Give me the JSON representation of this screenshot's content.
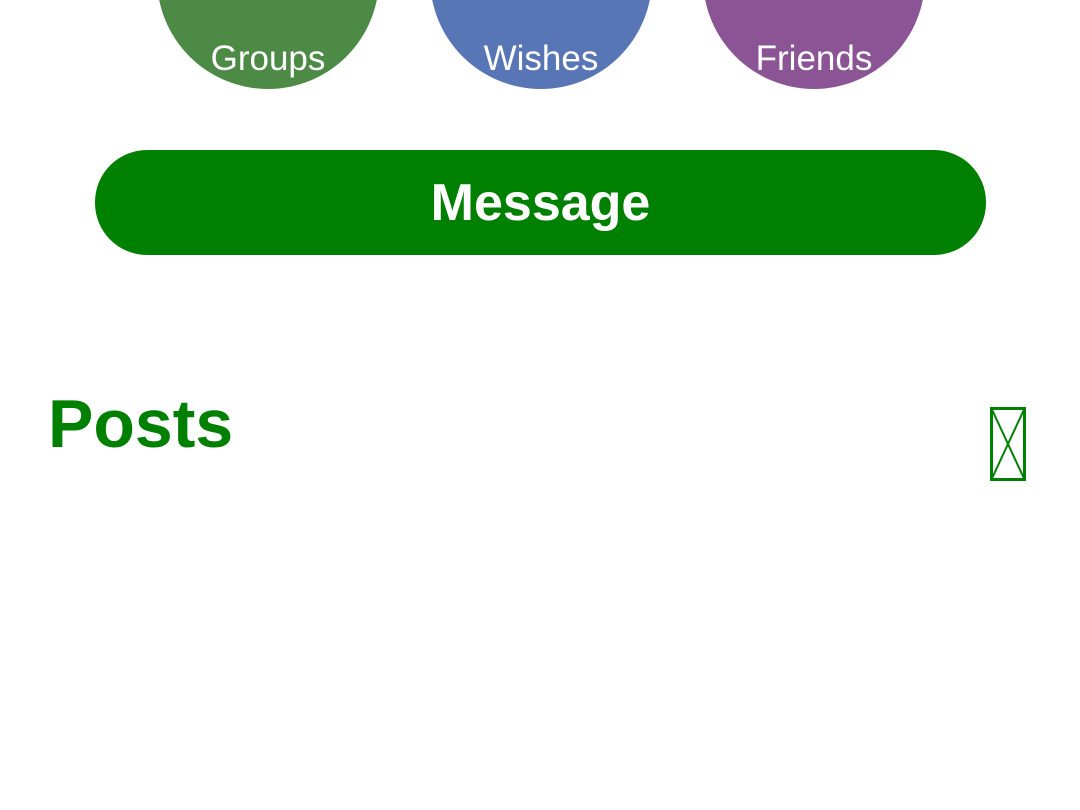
{
  "colors": {
    "groups_circle": "#4c8a45",
    "wishes_circle": "#5875b5",
    "friends_circle": "#8b5595",
    "primary_green": "#008000",
    "background": "#ffffff"
  },
  "shortcuts": [
    {
      "label": "Groups"
    },
    {
      "label": "Wishes"
    },
    {
      "label": "Friends"
    }
  ],
  "message_button": {
    "label": "Message"
  },
  "posts": {
    "title": "Posts",
    "action_icon": "missing-glyph-icon"
  }
}
